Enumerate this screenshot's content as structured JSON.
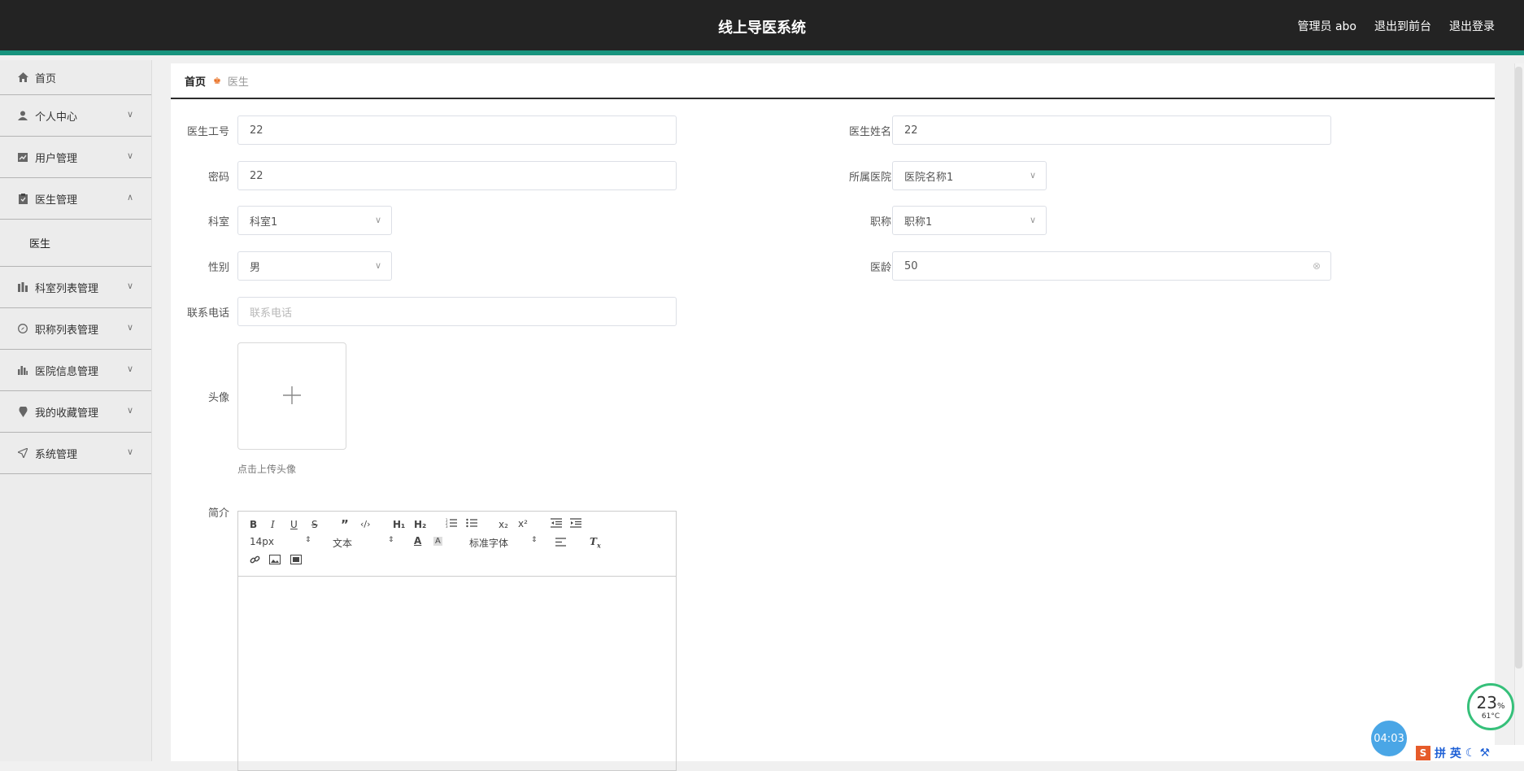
{
  "header": {
    "title": "线上导医系统",
    "user": "管理员 abo",
    "front_link": "退出到前台",
    "logout_link": "退出登录"
  },
  "sidebar": {
    "items": [
      {
        "label": "首页",
        "icon": "home-icon"
      },
      {
        "label": "个人中心",
        "icon": "user-icon"
      },
      {
        "label": "用户管理",
        "icon": "chart-icon"
      },
      {
        "label": "医生管理",
        "icon": "clipboard-icon",
        "expanded": true,
        "children": [
          "医生"
        ]
      },
      {
        "label": "科室列表管理",
        "icon": "bar-icon"
      },
      {
        "label": "职称列表管理",
        "icon": "compass-icon"
      },
      {
        "label": "医院信息管理",
        "icon": "stats-icon"
      },
      {
        "label": "我的收藏管理",
        "icon": "pin-icon"
      },
      {
        "label": "系统管理",
        "icon": "send-icon"
      }
    ]
  },
  "breadcrumb": {
    "home": "首页",
    "current": "医生"
  },
  "form": {
    "doctor_no": {
      "label": "医生工号",
      "value": "22"
    },
    "doctor_name": {
      "label": "医生姓名",
      "value": "22"
    },
    "password": {
      "label": "密码",
      "value": "22"
    },
    "hospital": {
      "label": "所属医院",
      "value": "医院名称1"
    },
    "department": {
      "label": "科室",
      "value": "科室1"
    },
    "title": {
      "label": "职称",
      "value": "职称1"
    },
    "gender": {
      "label": "性别",
      "value": "男"
    },
    "experience": {
      "label": "医龄",
      "value": "50"
    },
    "phone": {
      "label": "联系电话",
      "placeholder": "联系电话"
    },
    "avatar": {
      "label": "头像",
      "hint": "点击上传头像"
    },
    "intro": {
      "label": "简介"
    }
  },
  "editor": {
    "font_size": "14px",
    "text_type": "文本",
    "font_family": "标准字体"
  },
  "system_tray": {
    "cpu_percent": "23",
    "cpu_unit": "%",
    "temperature": "61°C",
    "clock": "04:03",
    "ime_text": "拼 英"
  }
}
